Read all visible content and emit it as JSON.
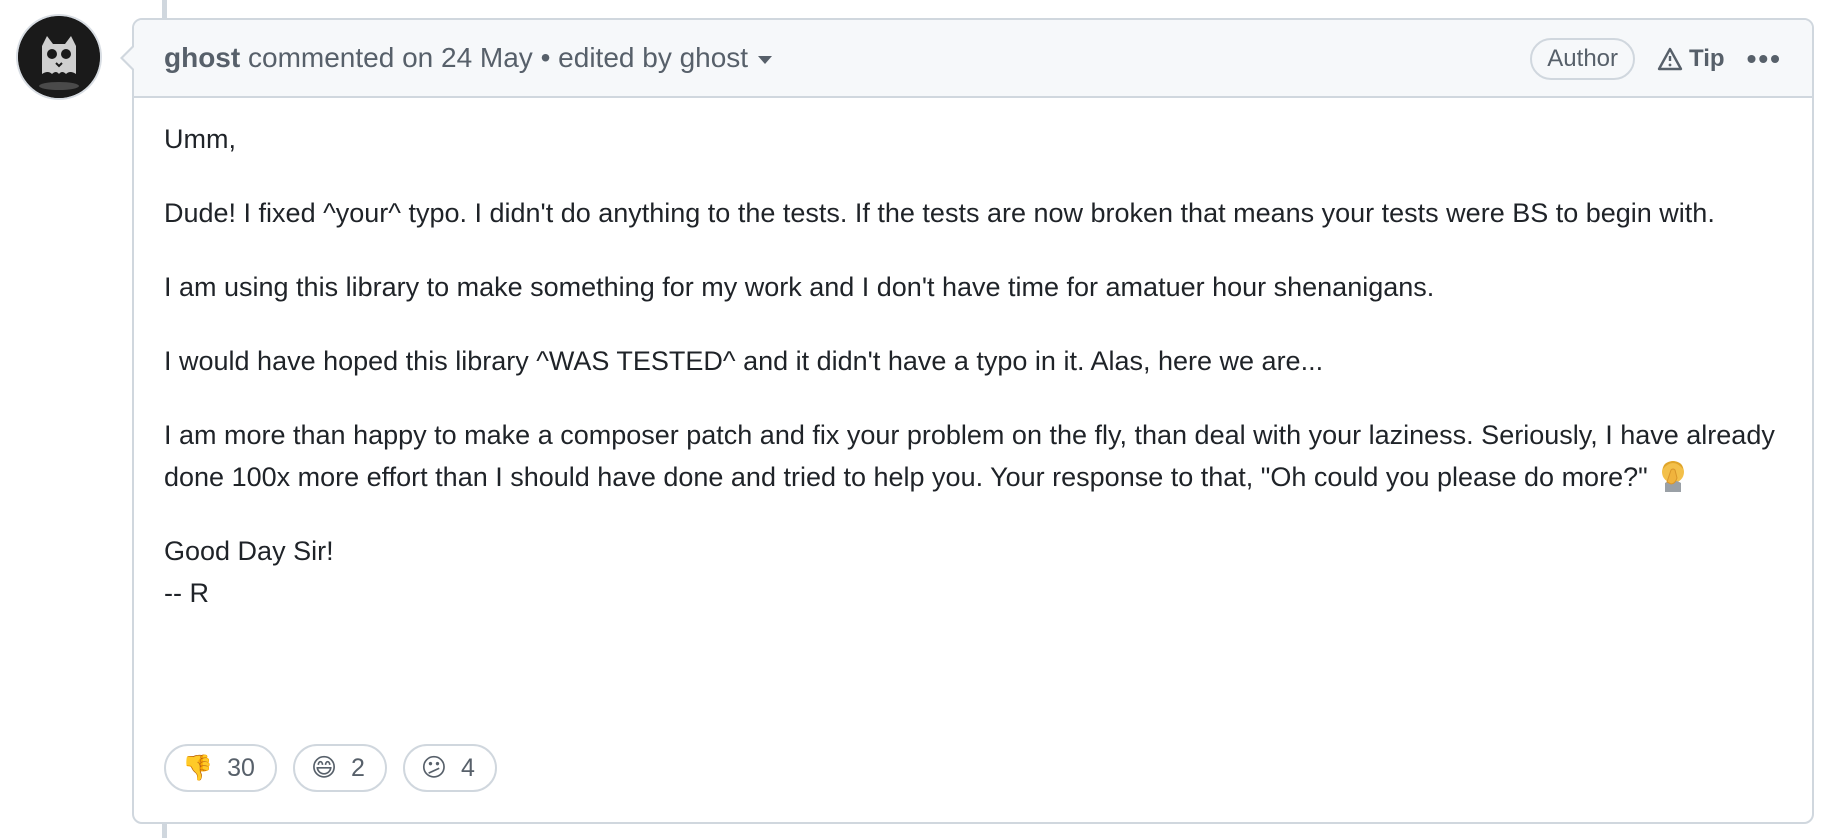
{
  "comment": {
    "author": "ghost",
    "meta": " commented on 24 May • edited by ghost",
    "badge": "Author",
    "tip_label": "Tip",
    "paragraphs": [
      "Umm,",
      "Dude! I fixed ^your^ typo. I didn't do anything to the tests. If the tests are now broken that means your tests were BS to begin with.",
      "I am using this library to make something for my work and I don't have time for amatuer hour shenanigans.",
      "I would have hoped this library ^WAS TESTED^ and it didn't have a typo in it. Alas, here we are...",
      "I am more than happy to make a composer patch and fix your problem on the fly, than deal with your laziness. Seriously, I have already done 100x more effort than I should have done and tried to help you. Your response to that, \"Oh could you please do more?\""
    ],
    "signoff_line1": "Good Day Sir!",
    "signoff_line2": "-- R",
    "reactions": [
      {
        "icon": "thumbs-down-icon",
        "emoji": "👎",
        "count": "30"
      },
      {
        "icon": "grinning-face-icon",
        "emoji": "😄",
        "count": "2"
      },
      {
        "icon": "confused-face-icon",
        "emoji": "😕",
        "count": "4"
      }
    ]
  },
  "colors": {
    "border": "#d0d7de",
    "header_bg": "#f6f8fa",
    "muted_text": "#57606a",
    "body_text": "#1f2328"
  }
}
